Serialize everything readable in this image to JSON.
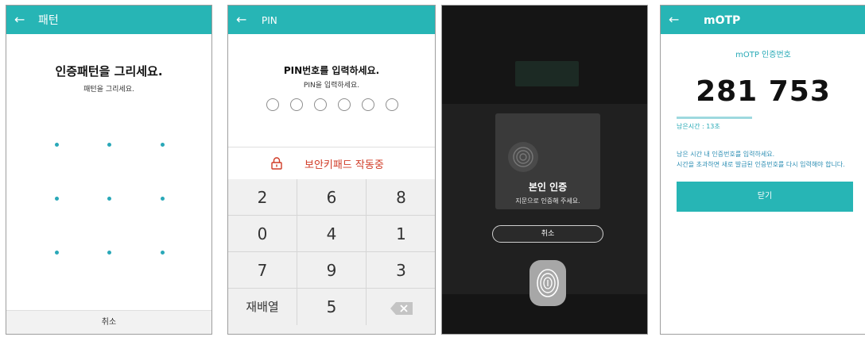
{
  "screen1": {
    "title": "패턴",
    "heading": "인증패턴을 그리세요.",
    "subheading": "패턴을 그리세요.",
    "cancel": "취소"
  },
  "screen2": {
    "title": "PIN",
    "heading": "PIN번호를 입력하세요.",
    "subheading": "PIN을 입력하세요.",
    "secure_keypad": "보안키패드 작동중",
    "keys": [
      "2",
      "6",
      "8",
      "0",
      "4",
      "1",
      "7",
      "9",
      "3",
      "재배열",
      "5"
    ]
  },
  "screen3": {
    "dialog_title": "본인 인증",
    "dialog_message": "지문으로 인증해 주세요.",
    "cancel": "취소"
  },
  "screen4": {
    "title": "mOTP",
    "heading": "mOTP 인증번호",
    "code": "281 753",
    "remaining_label": "남은시간 : 13초",
    "remaining_fraction": 0.45,
    "info1": "남은 시간 내 인증번호를 입력하세요.",
    "info2": "시간을 초과하면 새로 발급된 인증번호를 다시 입력해야 합니다.",
    "close": "닫기"
  },
  "colors": {
    "accent": "#27b5b5",
    "secure_red": "#d03b26",
    "pattern_dot": "#2aa8b8"
  }
}
